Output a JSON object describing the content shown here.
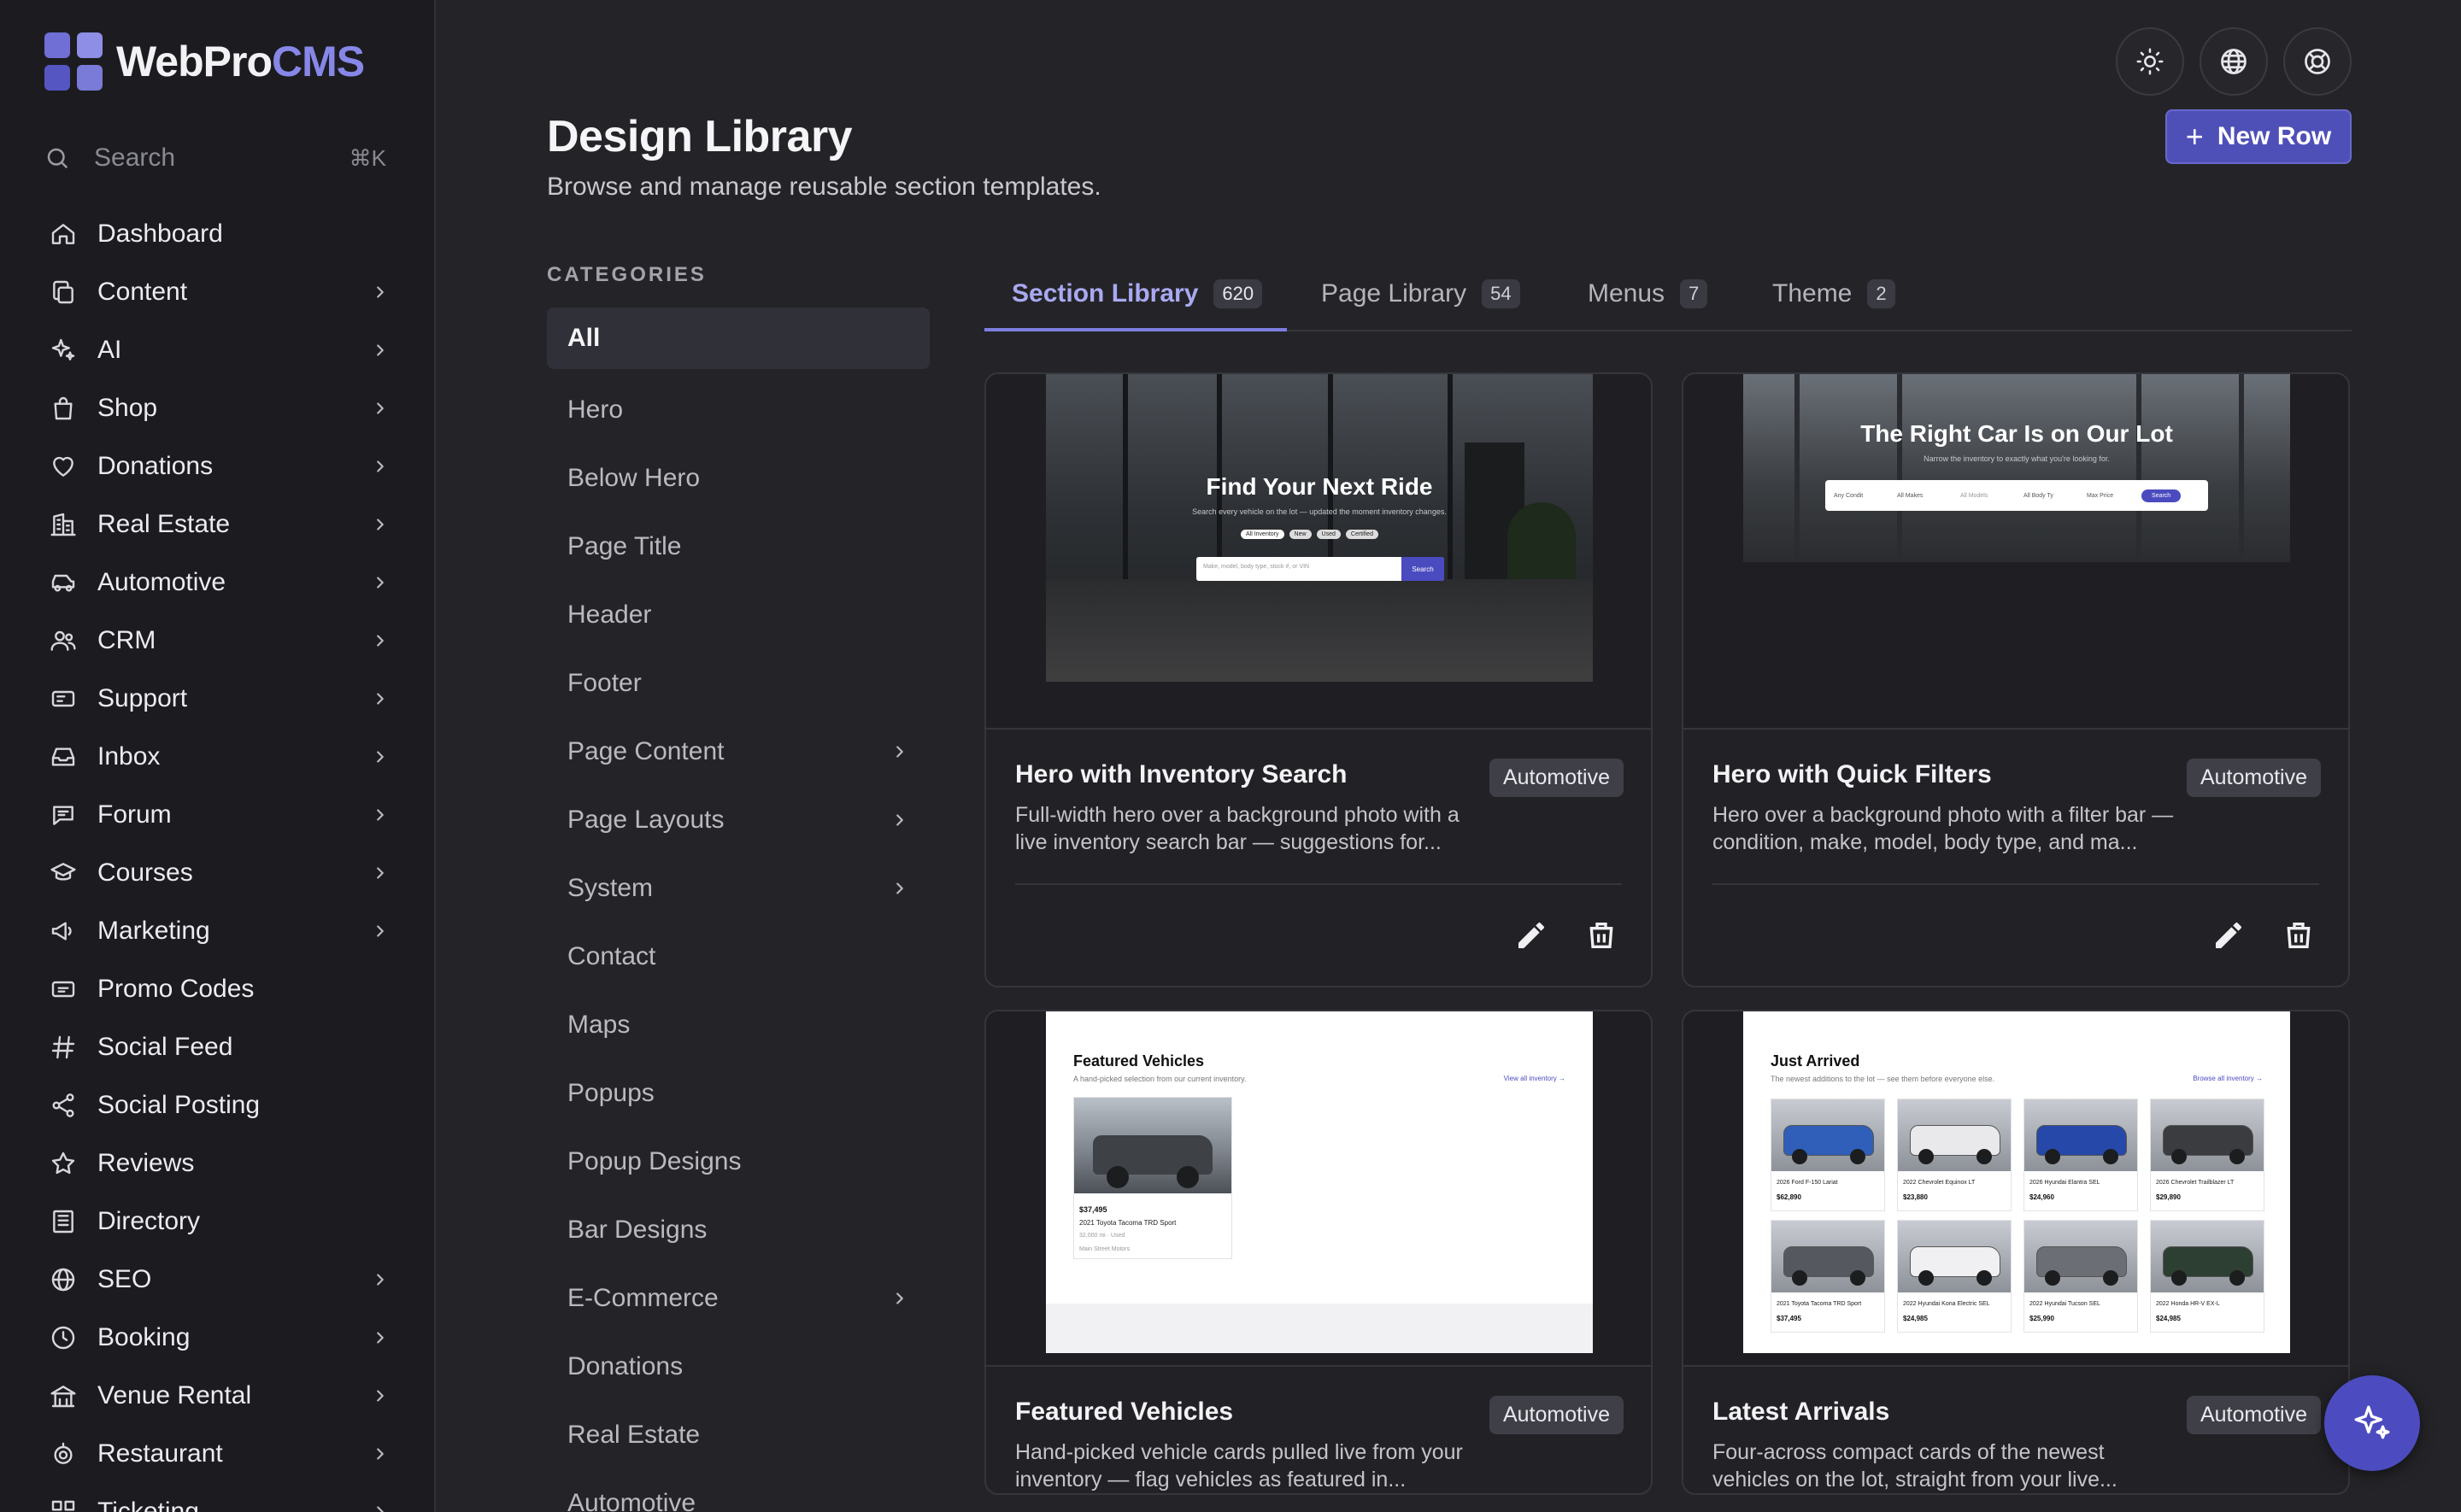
{
  "app": {
    "logo_web": "WebPro",
    "logo_cms": "CMS",
    "search_placeholder": "Search",
    "search_shortcut": "⌘K"
  },
  "sidebar": {
    "items": [
      {
        "label": "Dashboard",
        "icon": "home-icon",
        "has_children": false
      },
      {
        "label": "Content",
        "icon": "copy-icon",
        "has_children": true
      },
      {
        "label": "AI",
        "icon": "sparkles-icon",
        "has_children": true
      },
      {
        "label": "Shop",
        "icon": "shopping-bag-icon",
        "has_children": true
      },
      {
        "label": "Donations",
        "icon": "heart-icon",
        "has_children": true
      },
      {
        "label": "Real Estate",
        "icon": "building-icon",
        "has_children": true
      },
      {
        "label": "Automotive",
        "icon": "car-icon",
        "has_children": true
      },
      {
        "label": "CRM",
        "icon": "users-icon",
        "has_children": true
      },
      {
        "label": "Support",
        "icon": "ticket-icon",
        "has_children": true
      },
      {
        "label": "Inbox",
        "icon": "inbox-icon",
        "has_children": true
      },
      {
        "label": "Forum",
        "icon": "chat-icon",
        "has_children": true
      },
      {
        "label": "Courses",
        "icon": "graduation-cap-icon",
        "has_children": true
      },
      {
        "label": "Marketing",
        "icon": "megaphone-icon",
        "has_children": true
      },
      {
        "label": "Promo Codes",
        "icon": "coupon-icon",
        "has_children": false
      },
      {
        "label": "Social Feed",
        "icon": "hash-icon",
        "has_children": false
      },
      {
        "label": "Social Posting",
        "icon": "share-icon",
        "has_children": false
      },
      {
        "label": "Reviews",
        "icon": "star-icon",
        "has_children": false
      },
      {
        "label": "Directory",
        "icon": "directory-icon",
        "has_children": false
      },
      {
        "label": "SEO",
        "icon": "globe-icon",
        "has_children": true
      },
      {
        "label": "Booking",
        "icon": "clock-icon",
        "has_children": true
      },
      {
        "label": "Venue Rental",
        "icon": "venue-icon",
        "has_children": true
      },
      {
        "label": "Restaurant",
        "icon": "restaurant-icon",
        "has_children": true
      },
      {
        "label": "Ticketing",
        "icon": "qr-icon",
        "has_children": true
      }
    ]
  },
  "header": {
    "title": "Design Library",
    "subtitle": "Browse and manage reusable section templates.",
    "new_row_label": "New Row"
  },
  "categories": {
    "heading": "CATEGORIES",
    "items": [
      {
        "label": "All",
        "active": true,
        "has_children": false
      },
      {
        "label": "Hero",
        "has_children": false
      },
      {
        "label": "Below Hero",
        "has_children": false
      },
      {
        "label": "Page Title",
        "has_children": false
      },
      {
        "label": "Header",
        "has_children": false
      },
      {
        "label": "Footer",
        "has_children": false
      },
      {
        "label": "Page Content",
        "has_children": true
      },
      {
        "label": "Page Layouts",
        "has_children": true
      },
      {
        "label": "System",
        "has_children": true
      },
      {
        "label": "Contact",
        "has_children": false
      },
      {
        "label": "Maps",
        "has_children": false
      },
      {
        "label": "Popups",
        "has_children": false
      },
      {
        "label": "Popup Designs",
        "has_children": false
      },
      {
        "label": "Bar Designs",
        "has_children": false
      },
      {
        "label": "E-Commerce",
        "has_children": true
      },
      {
        "label": "Donations",
        "has_children": false
      },
      {
        "label": "Real Estate",
        "has_children": false
      },
      {
        "label": "Automotive",
        "has_children": false
      }
    ]
  },
  "tabs": [
    {
      "label": "Section Library",
      "count": "620",
      "active": true
    },
    {
      "label": "Page Library",
      "count": "54"
    },
    {
      "label": "Menus",
      "count": "7"
    },
    {
      "label": "Theme",
      "count": "2"
    }
  ],
  "cards": [
    {
      "title": "Hero with Inventory Search",
      "badge": "Automotive",
      "description": "Full-width hero over a background photo with a live inventory search bar — suggestions for...",
      "thumb": {
        "headline": "Find Your Next Ride",
        "sub": "Search every vehicle on the lot — updated the moment inventory changes.",
        "chips": [
          "All Inventory",
          "New",
          "Used",
          "Certified"
        ],
        "search_placeholder": "Make, model, body type, stock #, or VIN",
        "search_button": "Search"
      }
    },
    {
      "title": "Hero with Quick Filters",
      "badge": "Automotive",
      "description": "Hero over a background photo with a filter bar — condition, make, model, body type, and ma...",
      "thumb": {
        "headline": "The Right Car Is on Our Lot",
        "sub": "Narrow the inventory to exactly what you're looking for.",
        "filters": [
          "Any Condit",
          "All Makes",
          "All Models",
          "All Body Ty",
          "Max Price"
        ],
        "search_button": "Search"
      }
    },
    {
      "title": "Featured Vehicles",
      "badge": "Automotive",
      "description": "Hand-picked vehicle cards pulled live from your inventory — flag vehicles as featured in...",
      "thumb": {
        "heading": "Featured Vehicles",
        "sub": "A hand-picked selection from our current inventory.",
        "link": "View all inventory →",
        "price": "$37,495",
        "name": "2021 Toyota Tacoma TRD Sport",
        "meta": "32,000 mi · Used",
        "dealer": "Main Street Motors"
      }
    },
    {
      "title": "Latest Arrivals",
      "badge": "Automotive",
      "description": "Four-across compact cards of the newest vehicles on the lot, straight from your live...",
      "thumb": {
        "heading": "Just Arrived",
        "sub": "The newest additions to the lot — see them before everyone else.",
        "link": "Browse all inventory →",
        "cars": [
          {
            "name": "2026 Ford F-150 Lariat",
            "price": "$62,890",
            "color": "#2f5fb8"
          },
          {
            "name": "2022 Chevrolet Equinox LT",
            "price": "$23,880",
            "color": "#e9e9ec"
          },
          {
            "name": "2026 Hyundai Elantra SEL",
            "price": "$24,960",
            "color": "#2648a8"
          },
          {
            "name": "2026 Chevrolet Trailblazer LT",
            "price": "$29,890",
            "color": "#3a3c40"
          },
          {
            "name": "2021 Toyota Tacoma TRD Sport",
            "price": "$37,495",
            "color": "#55585e"
          },
          {
            "name": "2022 Hyundai Kona Electric SEL",
            "price": "$24,985",
            "color": "#f0f0f2"
          },
          {
            "name": "2022 Hyundai Tucson SEL",
            "price": "$25,990",
            "color": "#6b6e74"
          },
          {
            "name": "2022 Honda HR-V EX-L",
            "price": "$24,985",
            "color": "#2d3f33"
          }
        ]
      }
    }
  ],
  "colors": {
    "accent": "#4f4fb8",
    "accent_text": "#a9a9f2",
    "background": "#242428",
    "sidebar": "#1c1c20"
  }
}
